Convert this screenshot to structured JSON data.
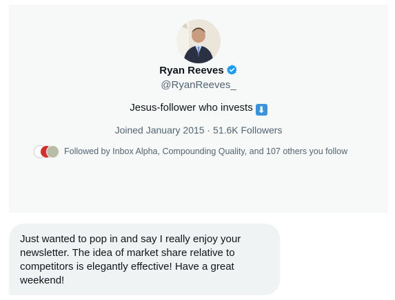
{
  "profile": {
    "name": "Ryan Reeves",
    "handle": "@RyanReeves_",
    "bio": "Jesus-follower who invests",
    "bio_emoji": "⬇",
    "joined": "Joined January 2015",
    "separator": "·",
    "followers": "51.6K Followers",
    "followed_by": "Followed by Inbox Alpha, Compounding Quality, and 107 others you follow",
    "verified_icon": "verified-badge-icon",
    "colors": {
      "verified": "#1d9bf0",
      "secondary_text": "#536471",
      "card_background": "#f7f9f9"
    }
  },
  "message": {
    "text": "Just wanted to pop in and say I really enjoy your newsletter. The idea of market share relative to competitors is elegantly effective! Have a great weekend!",
    "bubble_color": "#eff3f4"
  }
}
